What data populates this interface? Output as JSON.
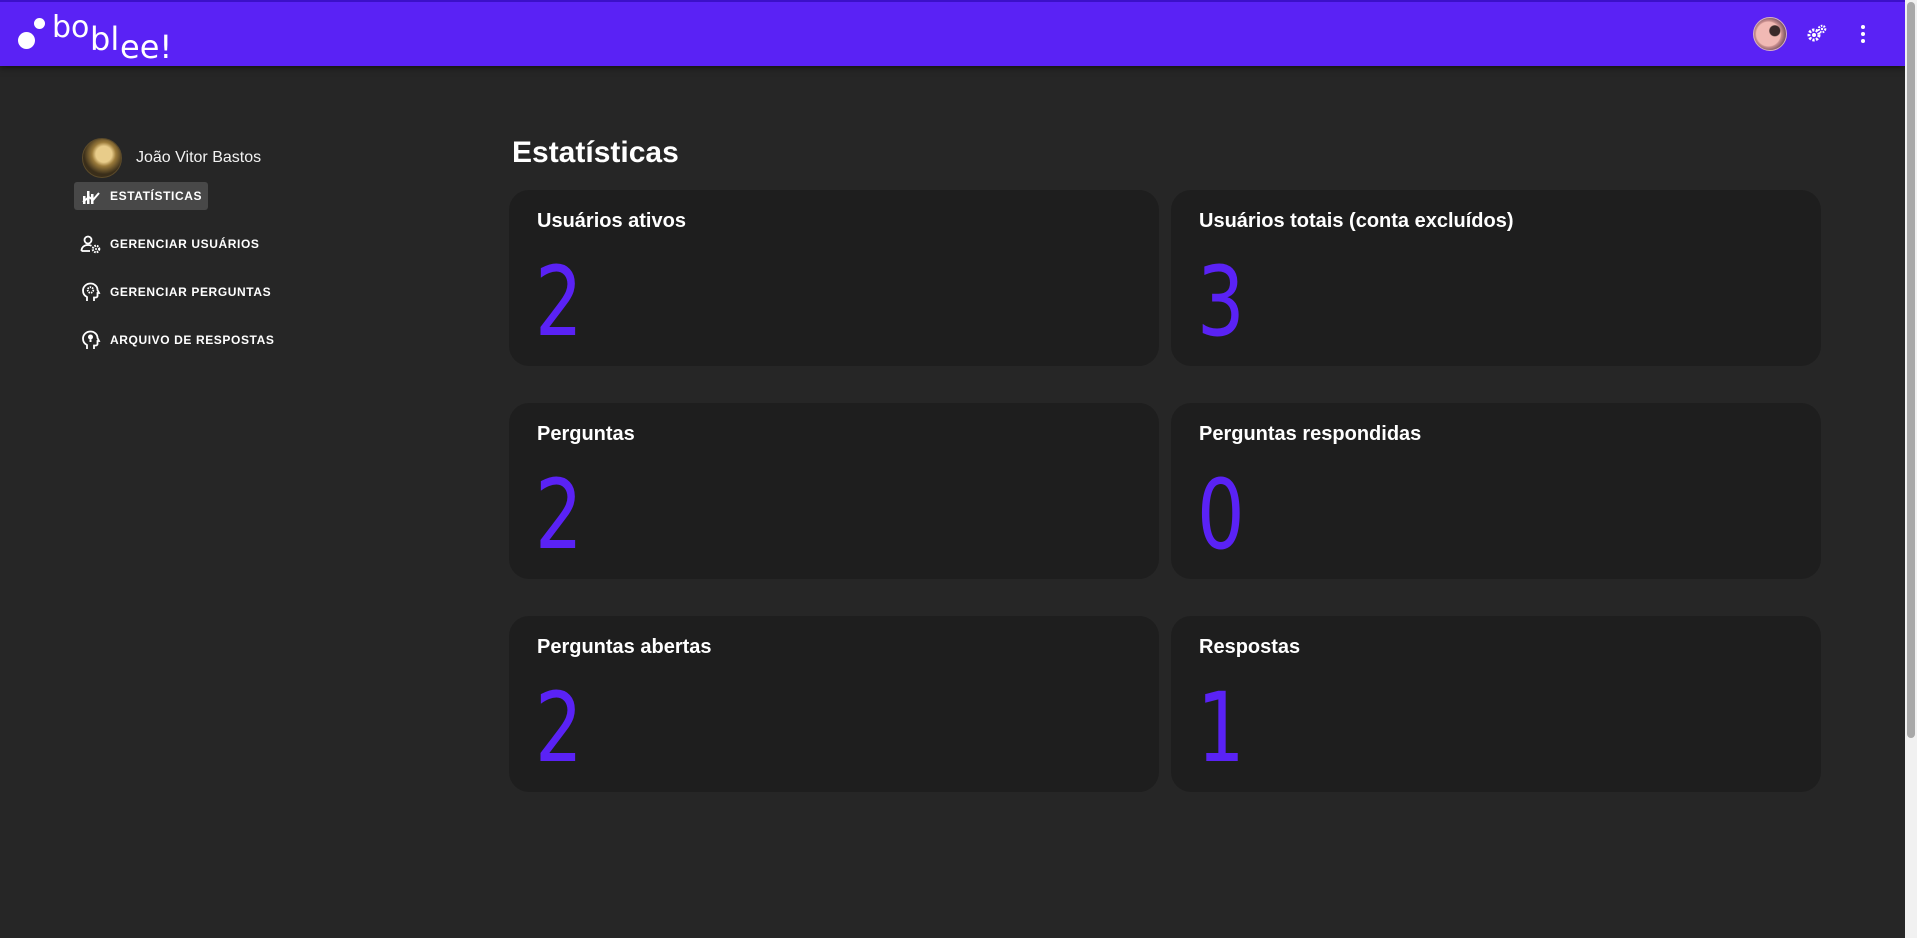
{
  "app": {
    "logo_text": [
      "bo",
      "bl",
      "ee!"
    ],
    "brand_color": "#5a22f5"
  },
  "header": {
    "icons": [
      "avatar",
      "settings-gears-icon",
      "more-vert-icon"
    ]
  },
  "sidebar": {
    "user_name": "João Vitor Bastos",
    "items": [
      {
        "label": "ESTATÍSTICAS",
        "icon": "stats-icon",
        "active": true
      },
      {
        "label": "GERENCIAR USUÁRIOS",
        "icon": "user-gear-icon",
        "active": false
      },
      {
        "label": "GERENCIAR PERGUNTAS",
        "icon": "head-gear-icon",
        "active": false
      },
      {
        "label": "ARQUIVO DE RESPOSTAS",
        "icon": "head-idea-icon",
        "active": false
      }
    ]
  },
  "main": {
    "title": "Estatísticas",
    "cards": [
      {
        "label": "Usuários ativos",
        "value": "2"
      },
      {
        "label": "Usuários totais (conta excluídos)",
        "value": "3"
      },
      {
        "label": "Perguntas",
        "value": "2"
      },
      {
        "label": "Perguntas respondidas",
        "value": "0"
      },
      {
        "label": "Perguntas abertas",
        "value": "2"
      },
      {
        "label": "Respostas",
        "value": "1"
      }
    ]
  }
}
